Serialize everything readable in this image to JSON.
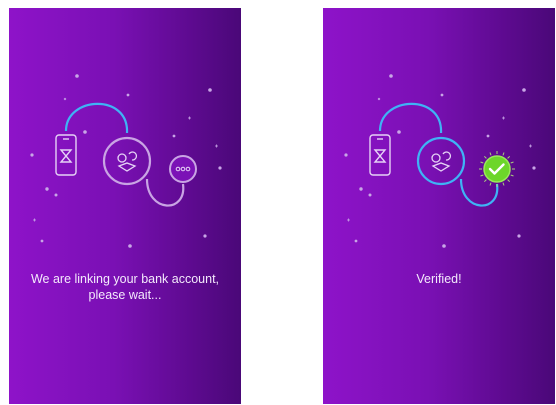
{
  "screens": {
    "linking": {
      "message_line1": "We are linking your bank account,",
      "message_line2": "please wait..."
    },
    "verified": {
      "message": "Verified!"
    }
  },
  "icons": {
    "phone": "smartphone-hourglass-icon",
    "bank": "bank-link-icon",
    "pending": "three-dots-pending-icon",
    "verified": "check-badge-icon"
  },
  "colors": {
    "gradient_start": "#8e13c9",
    "gradient_end": "#4a0878",
    "connector": "#3fb3f5",
    "connector_pending": "#c9a4e4",
    "verified_badge": "#6dd62a",
    "text": "#f4eafc"
  }
}
